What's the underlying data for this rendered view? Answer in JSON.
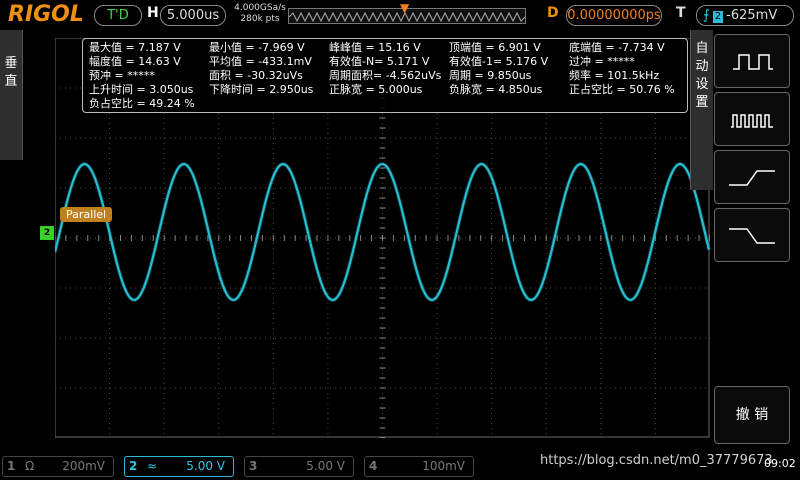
{
  "header": {
    "logo": "RIGOL",
    "trigger_state": "T'D",
    "h_label": "H",
    "timebase": "5.000us",
    "sample_rate": "4.000GSa/s",
    "memory_depth": "280k pts",
    "d_label": "D",
    "delay": "0.00000000ps",
    "t_label": "T",
    "trigger_channel": "2",
    "trigger_level": "-625mV"
  },
  "left_tab": {
    "label": "垂直"
  },
  "right_menu": {
    "tab_label": "自动设置",
    "buttons": [
      "square-wave-icon",
      "pulse-train-icon",
      "rising-edge-icon",
      "falling-edge-icon"
    ],
    "cancel_label": "撤 销"
  },
  "measurements": {
    "rows": [
      [
        "最大值  = 7.187 V",
        "最小值  = -7.969 V",
        "峰峰值  = 15.16 V",
        "顶端值  = 6.901 V",
        "底端值  = -7.734 V"
      ],
      [
        "幅度值  = 14.63 V",
        "平均值  = -433.1mV",
        "有效值-N= 5.171 V",
        "有效值-1= 5.176 V",
        "过冲   = *****"
      ],
      [
        "预冲   = *****",
        "面积   = -30.32uVs",
        "周期面积= -4.562uVs",
        "周期   = 9.850us",
        "频率   = 101.5kHz"
      ],
      [
        "上升时间 = 3.050us",
        "下降时间 = 2.950us",
        "正脉宽  = 5.000us",
        "负脉宽  = 4.850us",
        "正占空比 = 50.76 %"
      ],
      [
        "负占空比 = 49.24 %",
        "",
        "",
        "",
        ""
      ]
    ]
  },
  "waveform": {
    "channel_label": "2",
    "decoder_tag": "Parallel",
    "color": "#30d8e8",
    "cycles_visible": 6.6
  },
  "channels": [
    {
      "num": "1",
      "symbol": "Ω",
      "value": "200mV",
      "active": false
    },
    {
      "num": "2",
      "symbol": "≈",
      "value": "5.00 V",
      "active": true
    },
    {
      "num": "3",
      "symbol": "",
      "value": "5.00 V",
      "active": false
    },
    {
      "num": "4",
      "symbol": "",
      "value": "100mV",
      "active": false
    }
  ],
  "watermark": "https://blog.csdn.net/m0_37779673",
  "clock": "09:02",
  "colors": {
    "accent": "#f09010",
    "trace": "#30d8e8",
    "grid": "#5a5a5a"
  }
}
